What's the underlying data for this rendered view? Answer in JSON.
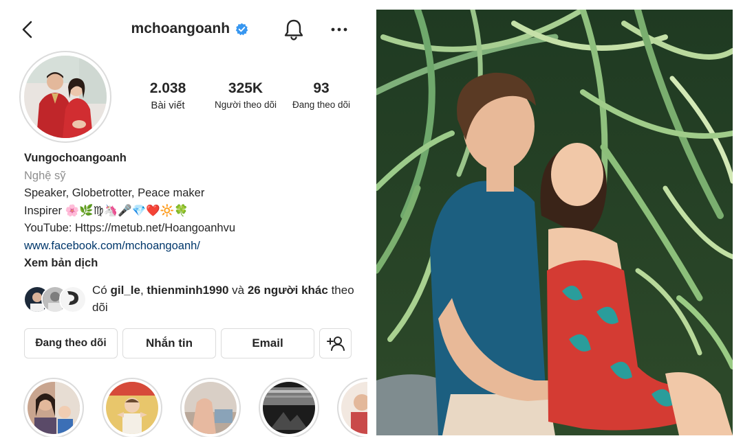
{
  "header": {
    "username": "mchoangoanh"
  },
  "stats": {
    "posts": {
      "value": "2.038",
      "label": "Bài viết"
    },
    "followers": {
      "value": "325K",
      "label": "Người theo dõi"
    },
    "following": {
      "value": "93",
      "label": "Đang theo dõi"
    }
  },
  "bio": {
    "name": "Vungochoangoanh",
    "category": "Nghệ sỹ",
    "line1": "Speaker, Globetrotter, Peace maker",
    "line2": "Inspirer 🌸🌿♍🦄🎤💎❤️🔆🍀",
    "line3": "YouTube: Https://metub.net/Hoangoanhvu",
    "link": "www.facebook.com/mchoangoanh/",
    "translate": "Xem bản dịch"
  },
  "mutual": {
    "prefix": "Có ",
    "user1": "gil_le",
    "sep": ", ",
    "user2": "thienminh1990",
    "and": " và ",
    "others": "26 người khác",
    "suffix": " theo dõi"
  },
  "buttons": {
    "following": "Đang theo dõi",
    "message": "Nhắn tin",
    "email": "Email"
  },
  "icons": {
    "back": "chevron-left-icon",
    "verified": "verified-badge-icon",
    "notifications": "bell-icon",
    "more": "more-horizontal-icon",
    "add_user": "add-user-icon"
  },
  "colors": {
    "verified": "#3897f0",
    "link": "#00376b",
    "secondary_text": "#8e8e8e",
    "border": "#dbdbdb"
  }
}
